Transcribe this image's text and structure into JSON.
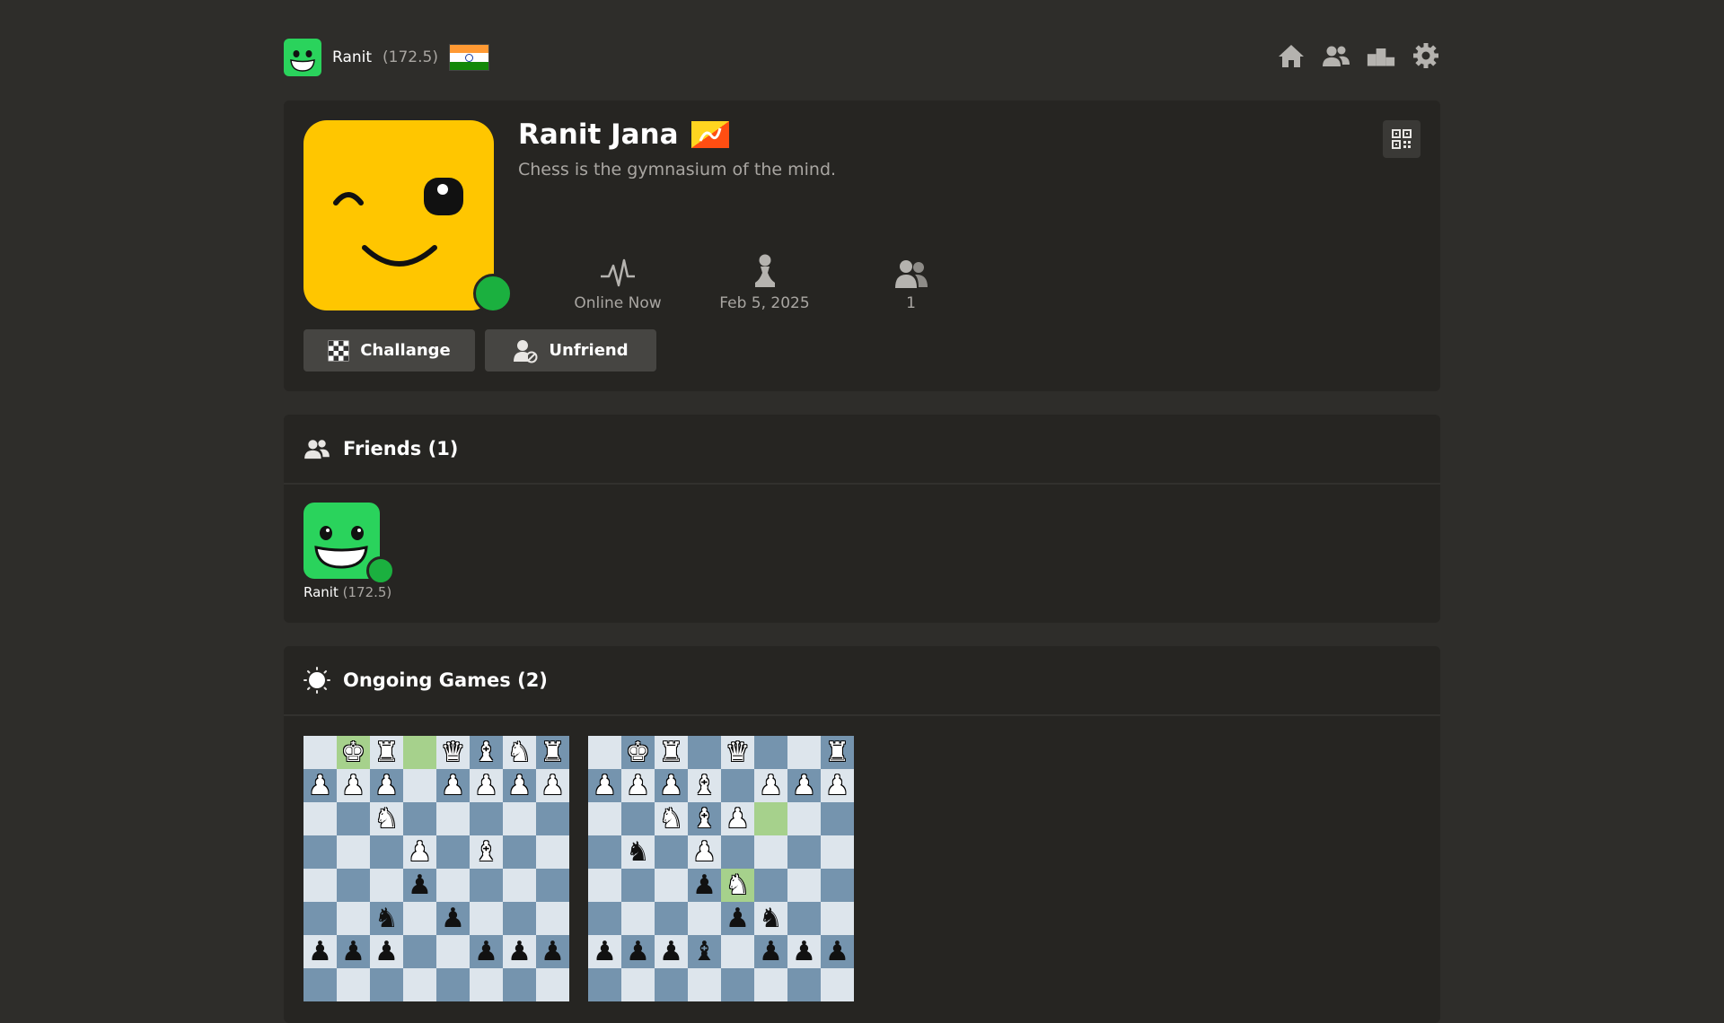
{
  "topbar": {
    "user_name": "Ranit",
    "user_rating": "(172.5)",
    "nav": [
      {
        "name": "home-icon"
      },
      {
        "name": "friends-icon"
      },
      {
        "name": "leaderboard-icon"
      },
      {
        "name": "settings-icon"
      }
    ]
  },
  "profile": {
    "name": "Ranit Jana",
    "bio": "Chess is the gymnasium of the mind.",
    "status": "Online Now",
    "joined": "Feb 5, 2025",
    "friends_count": "1",
    "challenge_label": "Challange",
    "unfriend_label": "Unfriend"
  },
  "friends": {
    "title": "Friends (1)",
    "items": [
      {
        "name": "Ranit",
        "rating": "(172.5)"
      }
    ]
  },
  "games": {
    "title": "Ongoing Games (2)",
    "boards": [
      {
        "rows": [
          [
            "",
            "wK",
            "wR",
            "",
            "wQ",
            "wB",
            "wN",
            "wR"
          ],
          [
            "wP",
            "wP",
            "wP",
            "",
            "wP",
            "wP",
            "wP",
            "wP"
          ],
          [
            "",
            "",
            "wN",
            "",
            "",
            "",
            "",
            ""
          ],
          [
            "",
            "",
            "",
            "wP",
            "",
            "wB",
            "",
            ""
          ],
          [
            "",
            "",
            "",
            "bP",
            "",
            "",
            "",
            ""
          ],
          [
            "",
            "",
            "bN",
            "",
            "bP",
            "",
            "",
            ""
          ],
          [
            "bP",
            "bP",
            "bP",
            "",
            "",
            "bP",
            "bP",
            "bP"
          ],
          [
            "",
            "",
            "",
            "",
            "",
            "",
            "",
            ""
          ]
        ],
        "highlights": [
          [
            0,
            1
          ],
          [
            0,
            3
          ]
        ]
      },
      {
        "rows": [
          [
            "",
            "wK",
            "wR",
            "",
            "wQ",
            "",
            "",
            "wR"
          ],
          [
            "wP",
            "wP",
            "wP",
            "wB",
            "",
            "wP",
            "wP",
            "wP"
          ],
          [
            "",
            "",
            "wN",
            "wB",
            "wP",
            "",
            "",
            ""
          ],
          [
            "",
            "bN",
            "",
            "wP",
            "",
            "",
            "",
            ""
          ],
          [
            "",
            "",
            "",
            "bP",
            "wN",
            "",
            "",
            ""
          ],
          [
            "",
            "",
            "",
            "",
            "bP",
            "bN",
            "",
            ""
          ],
          [
            "bP",
            "bP",
            "bP",
            "bB",
            "",
            "bP",
            "bP",
            "bP"
          ],
          [
            "",
            "",
            "",
            "",
            "",
            "",
            "",
            ""
          ]
        ],
        "highlights": [
          [
            2,
            5
          ],
          [
            4,
            4
          ]
        ]
      }
    ]
  },
  "colors": {
    "background": "#2e2d2a",
    "card": "#262522",
    "online": "#1bb03f",
    "avatar_yellow": "#ffc600",
    "avatar_green": "#2ad35c",
    "board_light": "#dde5ec",
    "board_dark": "#7594ae",
    "board_highlight": "#a6d18c"
  }
}
